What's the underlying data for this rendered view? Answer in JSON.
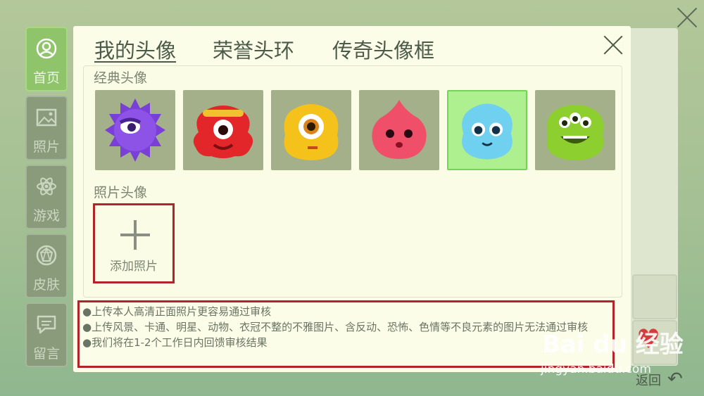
{
  "sidebar": {
    "items": [
      {
        "label": "首页",
        "icon": "user-circle-icon",
        "active": true
      },
      {
        "label": "照片",
        "icon": "image-icon",
        "active": false
      },
      {
        "label": "游戏",
        "icon": "atom-icon",
        "active": false
      },
      {
        "label": "皮肤",
        "icon": "gem-icon",
        "active": false
      },
      {
        "label": "留言",
        "icon": "chat-bubble-icon",
        "active": false
      }
    ]
  },
  "dialog": {
    "tabs": [
      {
        "label": "我的头像",
        "active": true
      },
      {
        "label": "荣誉头环",
        "active": false
      },
      {
        "label": "传奇头像框",
        "active": false
      }
    ],
    "classic_title": "经典头像",
    "photo_title": "照片头像",
    "add_photo_label": "添加照片",
    "avatars": [
      {
        "name": "purple-spiky-monster",
        "color": "#7a3fd6",
        "selected": false
      },
      {
        "name": "red-headband-monster",
        "color": "#e3262a",
        "selected": false
      },
      {
        "name": "yellow-one-eye-monster",
        "color": "#f4c21a",
        "selected": false
      },
      {
        "name": "pink-blob-monster",
        "color": "#ef4f68",
        "selected": false
      },
      {
        "name": "blue-fluffy-monster",
        "color": "#6fd0f0",
        "selected": true
      },
      {
        "name": "green-three-eye-monster",
        "color": "#8ccf2e",
        "selected": false
      }
    ],
    "notes": [
      "●上传本人高清正面照片更容易通过审核",
      "●上传风景、卡通、明星、动物、衣冠不整的不雅图片、含反动、恐怖、色情等不良元素的图片无法通过审核",
      "●我们将在1-2个工作日内回馈审核结果"
    ]
  },
  "footer": {
    "back_label": "返回",
    "watermark": "Bai du 经验",
    "watermark_url": "jingyan.baidu.com"
  },
  "colors": {
    "accent_red": "#b2232a",
    "active_green": "#8fc46b",
    "dialog_bg": "#fcfde9"
  }
}
